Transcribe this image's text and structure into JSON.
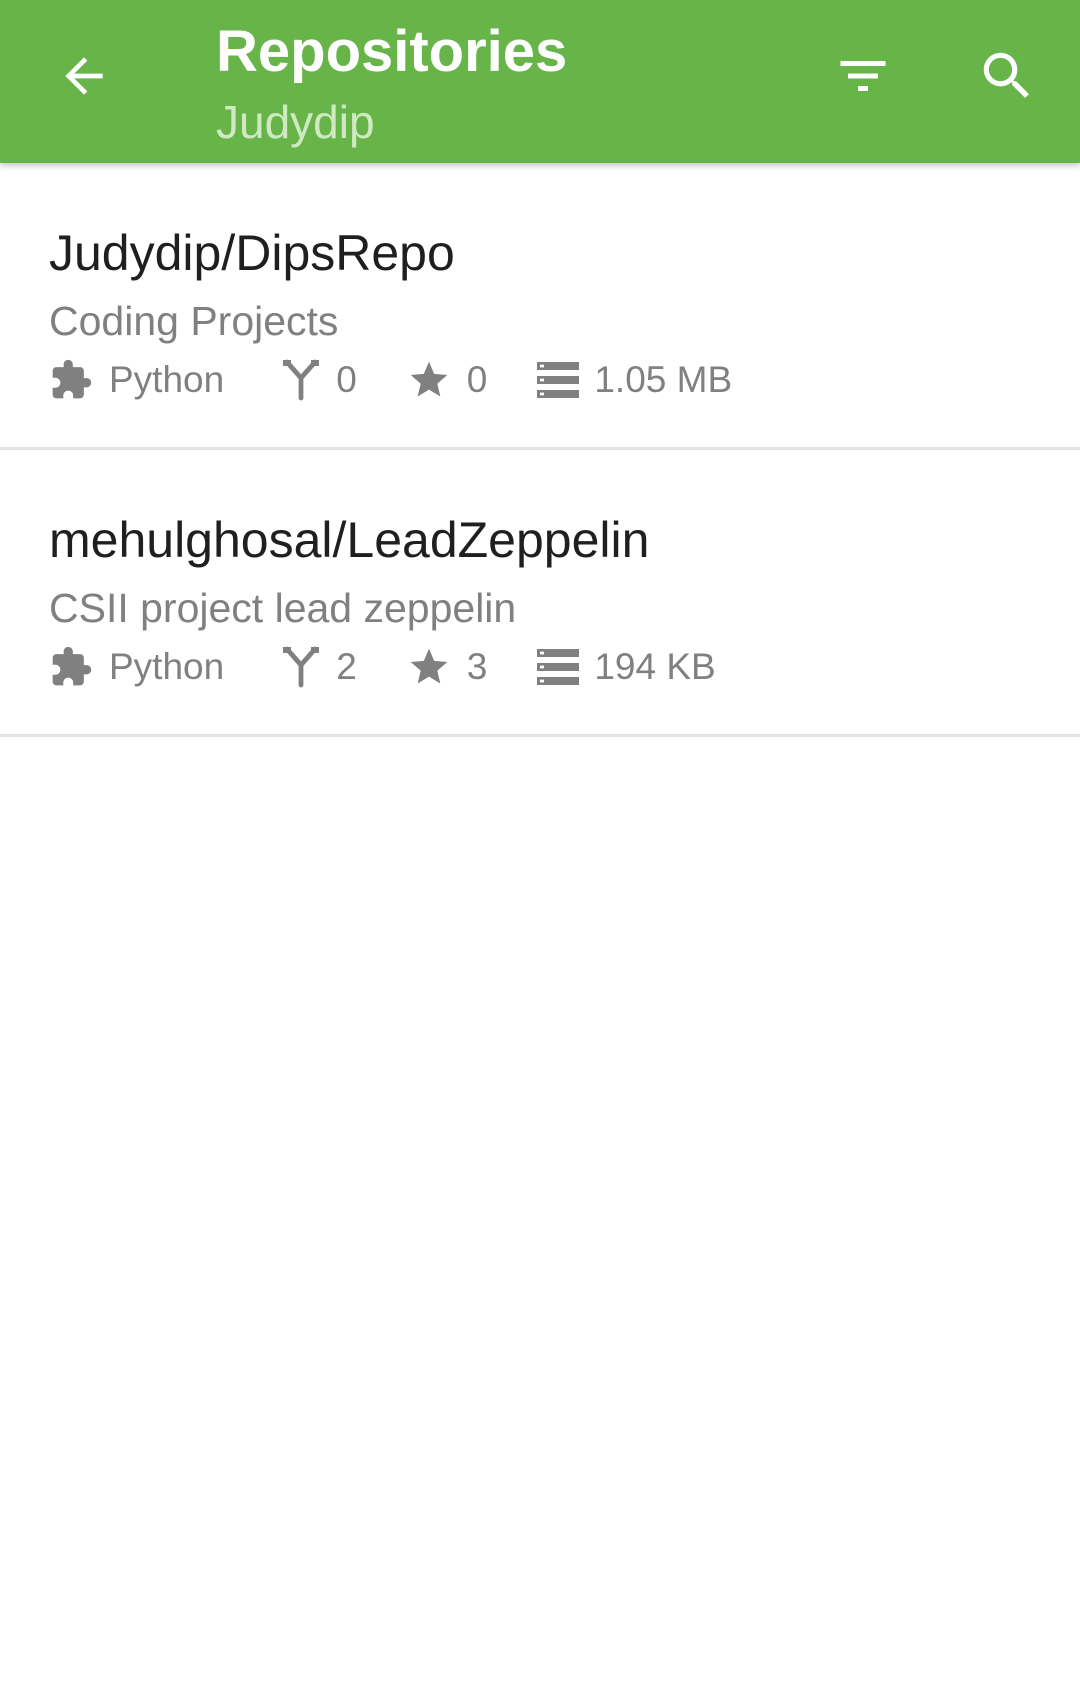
{
  "header": {
    "title": "Repositories",
    "subtitle": "Judydip",
    "back_icon": "arrow-back-icon",
    "filter_icon": "filter-icon",
    "search_icon": "search-icon"
  },
  "colors": {
    "appbar": "#67b548",
    "subtitle": "#cfeac3",
    "primary_text": "#1f1f1f",
    "secondary_text": "#808080",
    "divider": "#e3e3e3"
  },
  "repositories": [
    {
      "name": "Judydip/DipsRepo",
      "description": "Coding Projects",
      "language": "Python",
      "forks": "0",
      "stars": "0",
      "size": "1.05 MB"
    },
    {
      "name": "mehulghosal/LeadZeppelin",
      "description": "CSII project lead zeppelin",
      "language": "Python",
      "forks": "2",
      "stars": "3",
      "size": "194 KB"
    }
  ]
}
